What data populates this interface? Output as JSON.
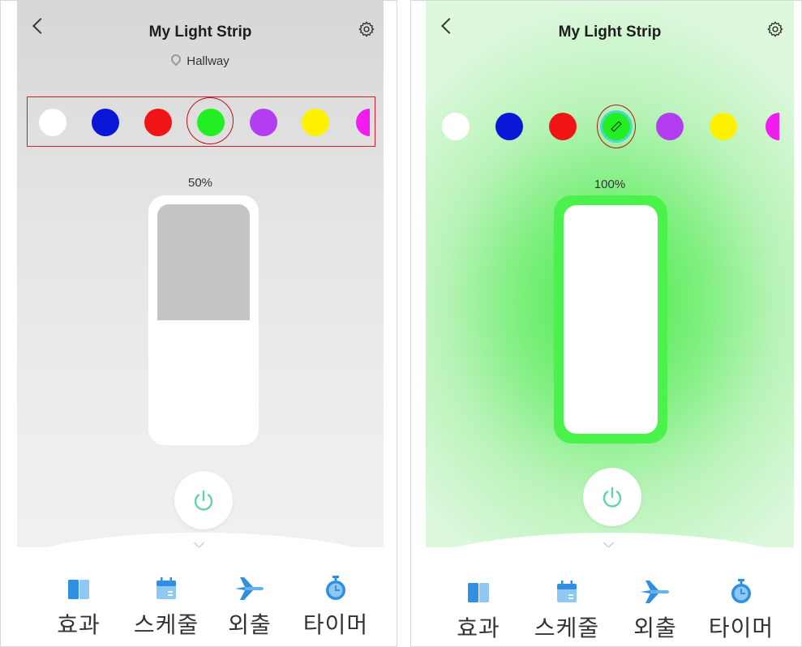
{
  "left_screen": {
    "title": "My Light Strip",
    "location": "Hallway",
    "brightness_label": "50%",
    "brightness_value": 0.5,
    "selected_color": "green",
    "palette_highlighted": true
  },
  "right_screen": {
    "title": "My Light Strip",
    "brightness_label": "100%",
    "brightness_value": 1.0,
    "selected_color": "green",
    "selected_editable": true
  },
  "palette": [
    {
      "name": "white",
      "hex": "#ffffff"
    },
    {
      "name": "blue",
      "hex": "#0a17d6"
    },
    {
      "name": "red",
      "hex": "#f01414"
    },
    {
      "name": "green",
      "hex": "#22ee22"
    },
    {
      "name": "purple",
      "hex": "#b23ef0"
    },
    {
      "name": "yellow",
      "hex": "#fff200"
    },
    {
      "name": "magenta",
      "hex": "#f21cee"
    }
  ],
  "bottom_nav": [
    {
      "label": "효과",
      "icon": "effects-icon"
    },
    {
      "label": "스케줄",
      "icon": "calendar-icon"
    },
    {
      "label": "외출",
      "icon": "airplane-icon"
    },
    {
      "label": "타이머",
      "icon": "timer-icon"
    }
  ],
  "colors": {
    "accent_green": "#5fd6a0",
    "nav_icon_blue": "#3aa0e6",
    "annotation_red": "#d21e2a"
  }
}
